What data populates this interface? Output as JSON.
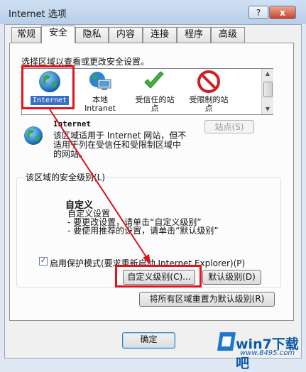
{
  "window": {
    "title": "Internet 选项",
    "help_glyph": "?",
    "close_glyph": "x"
  },
  "tabs": [
    "常规",
    "安全",
    "隐私",
    "内容",
    "连接",
    "程序",
    "高级"
  ],
  "active_tab": "安全",
  "security": {
    "zone_prompt": "选择区域以查看或更改安全设置。",
    "zones": [
      {
        "label": "Internet",
        "icon": "globe-icon",
        "selected": true
      },
      {
        "label": "本地\nIntranet",
        "icon": "intranet-icon"
      },
      {
        "label": "受信任的站\n点",
        "icon": "trusted-check-icon"
      },
      {
        "label": "受限制的站\n点",
        "icon": "restricted-icon"
      }
    ],
    "detail_title": "Internet",
    "detail_desc": "该区域适用于 Internet 网站，但不适用于列在受信任和受限制区域中的网站。",
    "sites_button": "站点(S)",
    "level_group_label": "该区域的安全级别(L)",
    "custom_title": "自定义",
    "custom_lines": [
      "自定义设置",
      "- 要更改设置，请单击“自定义级别”",
      "- 要使用推荐的设置，请单击“默认级别”"
    ],
    "protected_mode_label": "启用保护模式(要求重新启动 Internet Explorer)(P)",
    "protected_mode_checked": true,
    "custom_level_button": "自定义级别(C)...",
    "default_level_button": "默认级别(D)",
    "reset_all_button": "将所有区域重置为默认级别(R)"
  },
  "footer": {
    "ok_button": "确定"
  },
  "watermark": {
    "brand": "win7下载吧",
    "url": "www.8495.com"
  },
  "colors": {
    "highlight": "#e2131a",
    "selection": "#3a6fc7",
    "brand": "#0d5aa7"
  }
}
